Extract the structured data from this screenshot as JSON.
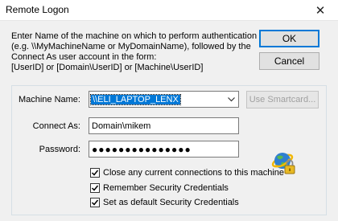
{
  "window": {
    "title": "Remote Logon",
    "close_glyph": "✕"
  },
  "description": {
    "lines": [
      "Enter Name of the machine on which to perform authentication",
      "(e.g. \\\\MyMachineName or MyDomainName), followed by the",
      "Connect As user account in the form:",
      "[UserID] or [Domain\\UserID] or [Machine\\UserID]"
    ]
  },
  "buttons": {
    "ok": "OK",
    "cancel": "Cancel",
    "smartcard": "Use Smartcard..."
  },
  "form": {
    "machine_label": "Machine Name:",
    "machine_value": "\\\\ELI_LAPTOP_LENX",
    "connect_label": "Connect As:",
    "connect_value": "Domain\\mikem",
    "password_label": "Password:",
    "password_value": "●●●●●●●●●●●●●●●"
  },
  "options": [
    {
      "label": "Close any current connections to this machine",
      "checked": true
    },
    {
      "label": "Remember Security Credentials",
      "checked": true
    },
    {
      "label": "Set as default Security Credentials",
      "checked": true
    }
  ],
  "icons": {
    "close": "close-icon",
    "dropdown": "chevron-down-icon",
    "globe_lock": "globe-lock-icon",
    "checkmark": "checkmark-icon"
  },
  "colors": {
    "selection": "#0078d7",
    "default_button_border": "#0078d7"
  }
}
